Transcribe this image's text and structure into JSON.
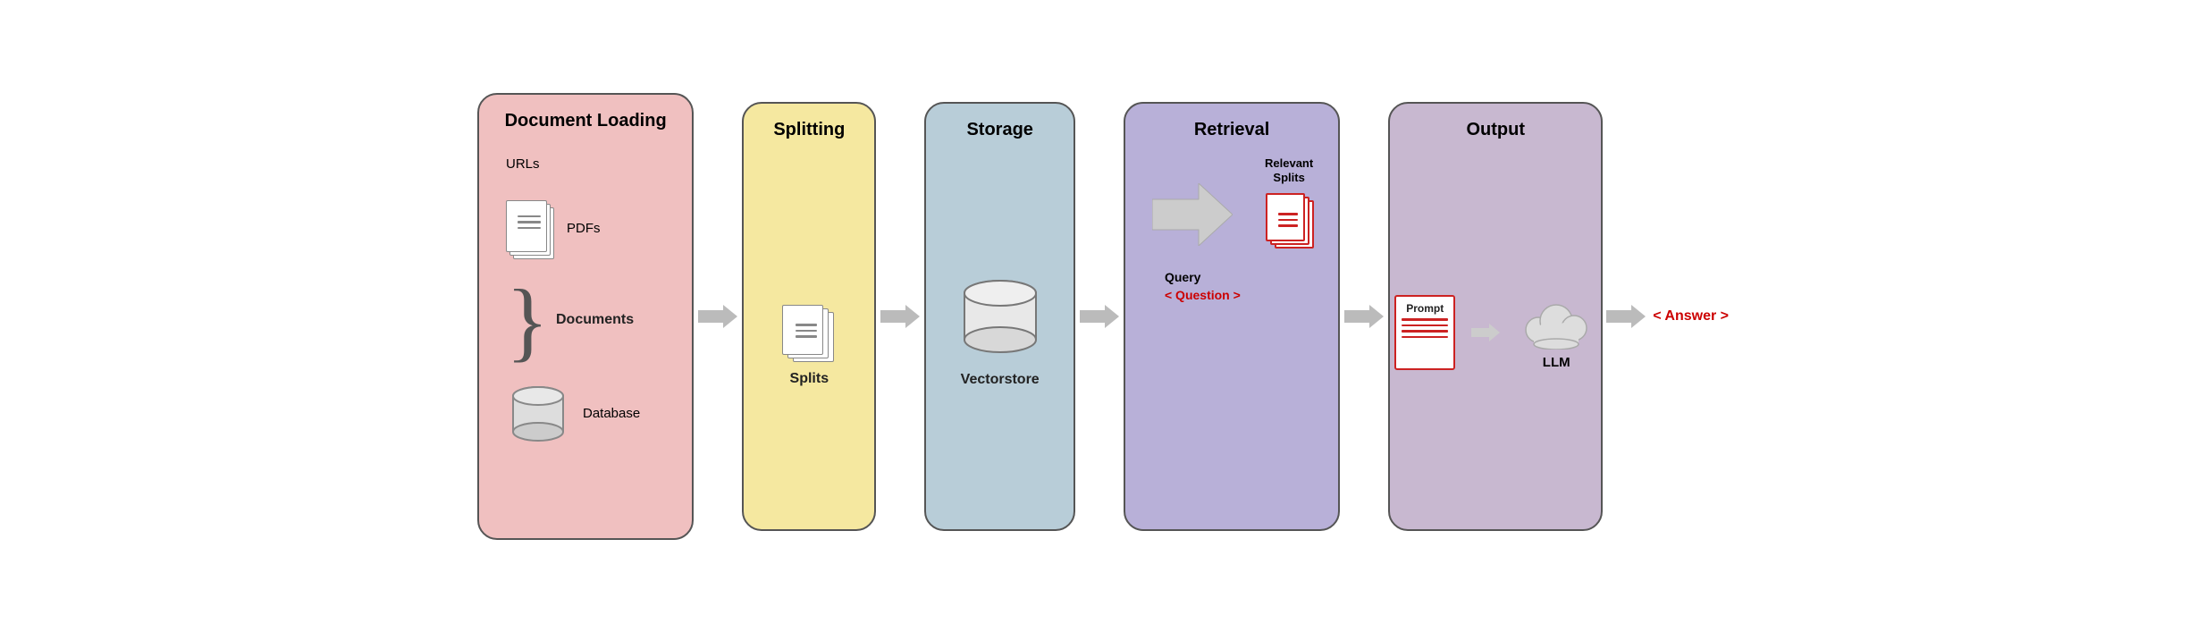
{
  "diagram": {
    "panels": [
      {
        "id": "doc-loading",
        "title": "Document Loading",
        "color": "#f0c0c0",
        "items": [
          "URLs",
          "PDFs",
          "Documents",
          "Database"
        ]
      },
      {
        "id": "splitting",
        "title": "Splitting",
        "color": "#f5e8a0",
        "items": [
          "Splits"
        ]
      },
      {
        "id": "storage",
        "title": "Storage",
        "color": "#b8cdd8",
        "items": [
          "Vectorstore"
        ]
      },
      {
        "id": "retrieval",
        "title": "Retrieval",
        "color": "#b8b0d8",
        "items": [
          "Relevant Splits",
          "Query",
          "< Question >"
        ]
      },
      {
        "id": "output",
        "title": "Output",
        "color": "#c8b8d0",
        "items": [
          "Prompt",
          "LLM"
        ]
      }
    ],
    "labels": {
      "urls": "URLs",
      "pdfs": "PDFs",
      "documents": "Documents",
      "database": "Database",
      "splits": "Splits",
      "vectorstore": "Vectorstore",
      "relevant_splits": "Relevant\nSplits",
      "relevant_splits_line1": "Relevant",
      "relevant_splits_line2": "Splits",
      "query": "Query",
      "question": "< Question >",
      "prompt": "Prompt",
      "llm": "LLM",
      "answer": "< Answer >"
    }
  }
}
